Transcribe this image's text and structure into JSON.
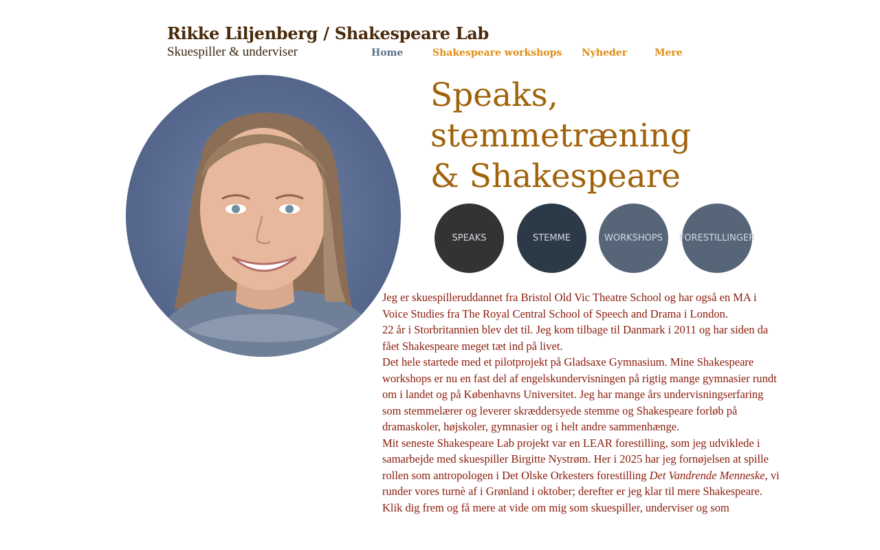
{
  "header": {
    "title": "Rikke Liljenberg / Shakespeare Lab",
    "subtitle": "Skuespiller & underviser"
  },
  "nav": {
    "items": [
      "Home",
      "Shakespeare workshops",
      "Nyheder",
      "Mere"
    ],
    "active": "Home"
  },
  "headline": {
    "line1": "Speaks,",
    "line2": "stemmetræning",
    "line3": "& Shakespeare"
  },
  "buttons": {
    "speaks": "SPEAKS",
    "stemme": "STEMME",
    "workshops": "WORKSHOPS",
    "forestillinger": "FORESTILLINGER"
  },
  "body": {
    "p1": "Jeg er skuespilleruddannet fra Bristol Old Vic Theatre School og har også en MA i Voice Studies fra The Royal Central School of Speech and Drama i London.",
    "p2": "22 år i Storbritannien blev det til. Jeg kom tilbage til Danmark i 2011 og har siden da fået Shakespeare meget tæt ind på livet.",
    "p3": "Det hele startede med et pilotprojekt på Gladsaxe Gymnasium. Mine Shakespeare workshops er nu en fast del af engelskundervisningen på rigtig mange gymnasier rundt om i landet og på Københavns Universitet. Jeg har mange års undervisningserfaring som stemmelærer og leverer skræddersyede stemme og Shakespeare forløb på dramaskoler, højskoler, gymnasier og i helt andre sammenhænge.",
    "p4_before": "Mit seneste Shakespeare Lab projekt var en LEAR forestilling, som jeg udviklede i samarbejde med skuespiller Birgitte Nystrøm. Her i 2025 har jeg fornøjelsen at spille rollen som antropologen i Det Olske Orkesters forestilling ",
    "p4_italic": "Det Vandrende Menneske,",
    "p4_after": " vi runder vores turnè af i Grønland i oktober; derefter er jeg klar til mere Shakespeare.",
    "p5": "Klik dig frem og få mere at vide om mig som skuespiller, underviser og som"
  },
  "colors": {
    "title": "#4a2a0a",
    "nav": "#e08c10",
    "nav_active": "#5a6f86",
    "headline": "#a0620a",
    "body": "#8a1a0a"
  }
}
